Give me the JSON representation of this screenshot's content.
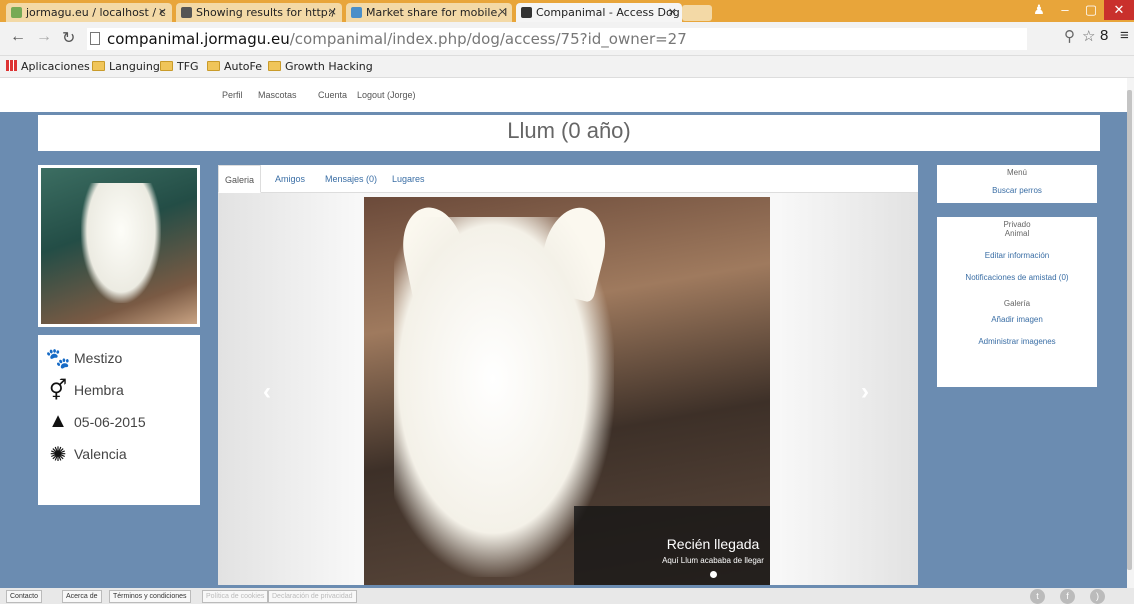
{
  "browser": {
    "tabs": [
      {
        "label": "jormagu.eu / localhost / c",
        "active": false
      },
      {
        "label": "Showing results for http:/",
        "active": false
      },
      {
        "label": "Market share for mobile, l",
        "active": false
      },
      {
        "label": "Companimal - Access Dog",
        "active": true
      }
    ],
    "url_host": "companimal.jormagu.eu",
    "url_path": "/companimal/index.php/dog/access/75?id_owner=27",
    "bookmarks": [
      "Aplicaciones",
      "Languing",
      "TFG",
      "AutoFe",
      "Growth Hacking"
    ]
  },
  "topnav": [
    "Perfil",
    "Mascotas",
    "Cuenta",
    "Logout (Jorge)"
  ],
  "page_title": "Llum (0 año)",
  "pet_info": {
    "breed": "Mestizo",
    "sex": "Hembra",
    "birthdate": "05-06-2015",
    "location": "Valencia"
  },
  "gallery_tabs": [
    "Galeria",
    "Amigos",
    "Mensajes (0)",
    "Lugares"
  ],
  "carousel": {
    "caption_title": "Recién llegada",
    "caption_text": "Aquí Llum acababa de llegar"
  },
  "menu": {
    "title": "Menú",
    "search": "Buscar perros"
  },
  "private": {
    "title": "Privado",
    "animal_heading": "Animal",
    "edit_info": "Editar información",
    "friend_notifications": "Notificaciones de amistad (0)",
    "gallery_heading": "Galería",
    "add_image": "Añadir imagen",
    "manage_images": "Administrar imagenes"
  },
  "footer": {
    "links": [
      "Contacto",
      "Acerca de",
      "Términos y condiciones"
    ],
    "disabled_links": [
      "Política de cookies",
      "Declaración de privacidad"
    ]
  },
  "colors": {
    "page_bg": "#6b8cb1",
    "link": "#3a6ea5",
    "browser_frame": "#e8a53a"
  }
}
